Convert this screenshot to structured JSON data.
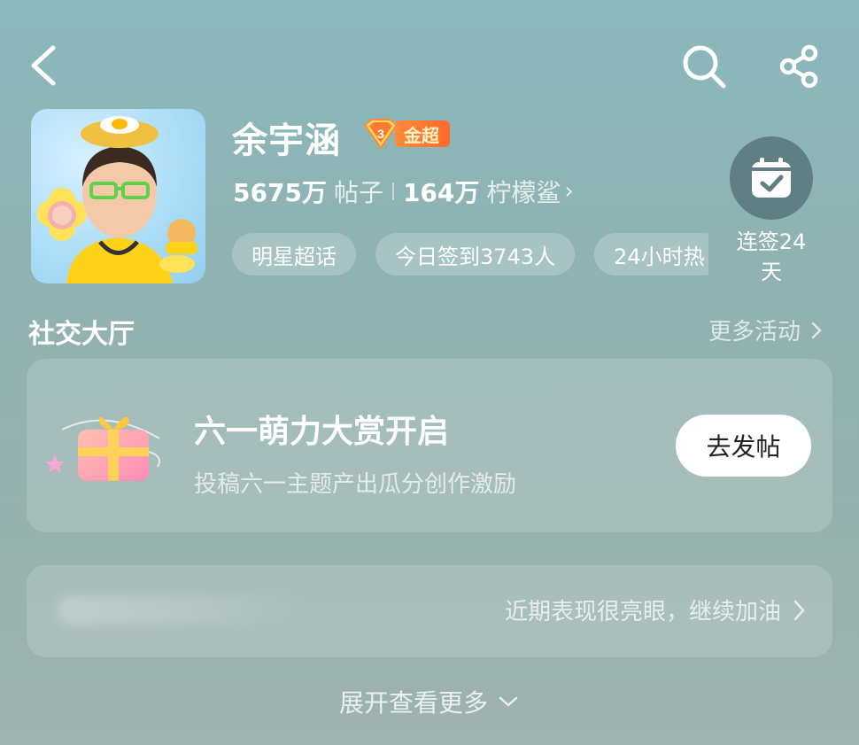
{
  "header": {
    "back_icon": "chevron-left-icon",
    "search_icon": "search-icon",
    "share_icon": "share-icon"
  },
  "profile": {
    "name": "余宇涵",
    "badge": {
      "level": "3",
      "label": "金超"
    },
    "stats": {
      "posts_value": "5675万",
      "posts_label": "帖子",
      "fans_value": "164万",
      "fans_label": "柠檬鲨"
    },
    "tags": [
      "明星超话",
      "今日签到3743人",
      "24小时热"
    ]
  },
  "checkin": {
    "icon": "calendar-check-icon",
    "label": "连签24天"
  },
  "social_hall": {
    "title": "社交大厅",
    "more": "更多活动"
  },
  "event_card": {
    "title": "六一萌力大赏开启",
    "subtitle": "投稿六一主题产出瓜分创作激励",
    "button": "去发帖"
  },
  "performance_card": {
    "text": "近期表现很亮眼，继续加油"
  },
  "expand": {
    "label": "展开查看更多"
  },
  "colors": {
    "background": "#8fb2b2",
    "badge_orange": "#ff7a30",
    "checkin_circle": "#5f7f85"
  }
}
